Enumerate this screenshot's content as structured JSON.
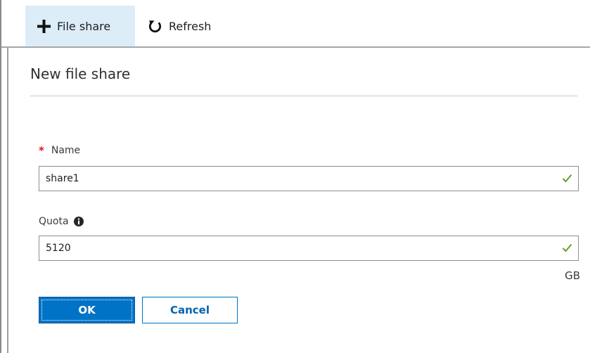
{
  "toolbar": {
    "file_share_label": "File share",
    "refresh_label": "Refresh",
    "icons": {
      "add": "plus-icon",
      "refresh": "refresh-icon"
    },
    "active_color": "#dcedf8"
  },
  "panel": {
    "title": "New file share",
    "name_field": {
      "label": "Name",
      "required_marker": "*",
      "value": "share1",
      "valid": true
    },
    "quota_field": {
      "label": "Quota",
      "value": "5120",
      "unit": "GB",
      "valid": true,
      "has_info_icon": true
    },
    "buttons": {
      "ok_label": "OK",
      "cancel_label": "Cancel"
    }
  },
  "colors": {
    "primary": "#0173c6",
    "required": "#e81123",
    "valid_check": "#5ea32a"
  }
}
